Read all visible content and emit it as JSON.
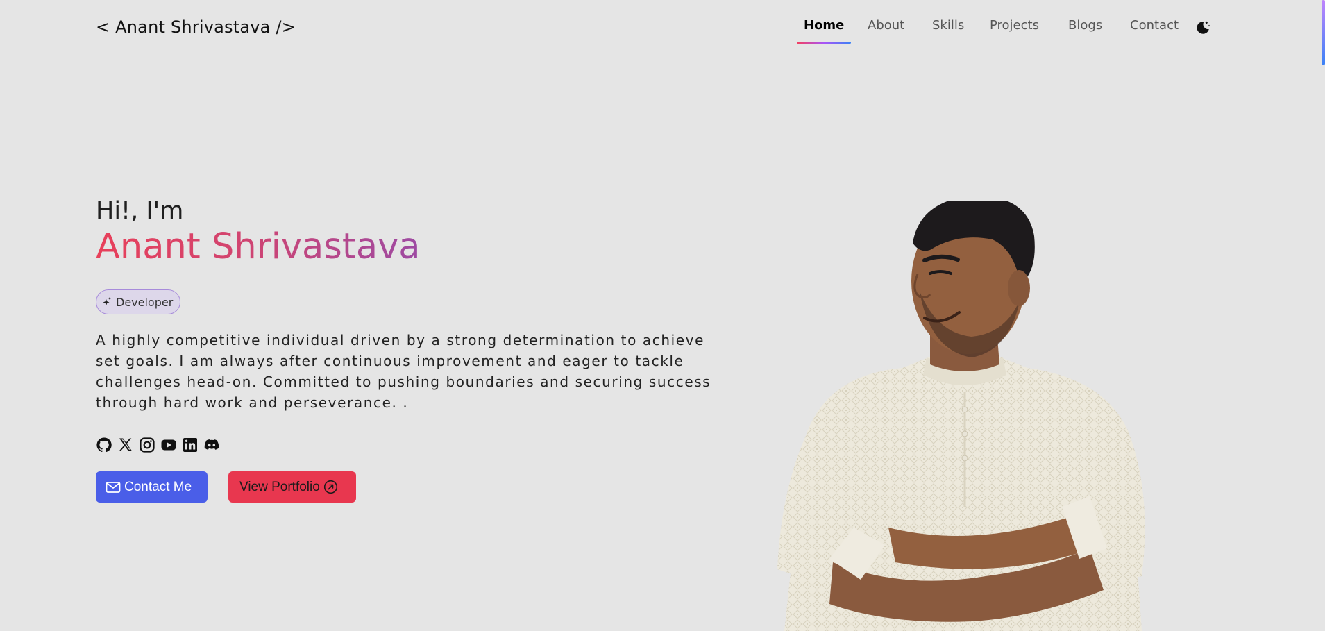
{
  "brand": {
    "label": "< Anant Shrivastava />"
  },
  "nav": {
    "items": [
      {
        "label": "Home",
        "active": true
      },
      {
        "label": "About",
        "active": false
      },
      {
        "label": "Skills",
        "active": false
      },
      {
        "label": "Projects",
        "active": false
      },
      {
        "label": "Blogs",
        "active": false
      },
      {
        "label": "Contact",
        "active": false
      }
    ],
    "theme_icon": "moon-stars-icon"
  },
  "hero": {
    "greeting": "Hi!, I'm",
    "name": "Anant Shrivastava",
    "badge": {
      "icon": "sparkles-icon",
      "label": "Developer"
    },
    "intro": "A highly competitive individual driven by a strong determination to achieve set goals. I am always after continuous improvement and eager to tackle challenges head-on. Committed to pushing boundaries and securing success through hard work and perseverance. .",
    "socials": [
      "github-icon",
      "x-twitter-icon",
      "instagram-icon",
      "youtube-icon",
      "linkedin-icon",
      "discord-icon"
    ],
    "buttons": {
      "contact": {
        "label": "Contact Me",
        "icon": "envelope-icon"
      },
      "portfolio": {
        "label": "View Portfolio",
        "icon": "arrow-up-right-circle-icon"
      }
    }
  },
  "colors": {
    "background": "#e5e5e5",
    "accent_blue": "#4a5ee8",
    "accent_red": "#e8374f",
    "name_gradient_start": "#e8405a",
    "name_gradient_end": "#9d4aa3"
  }
}
